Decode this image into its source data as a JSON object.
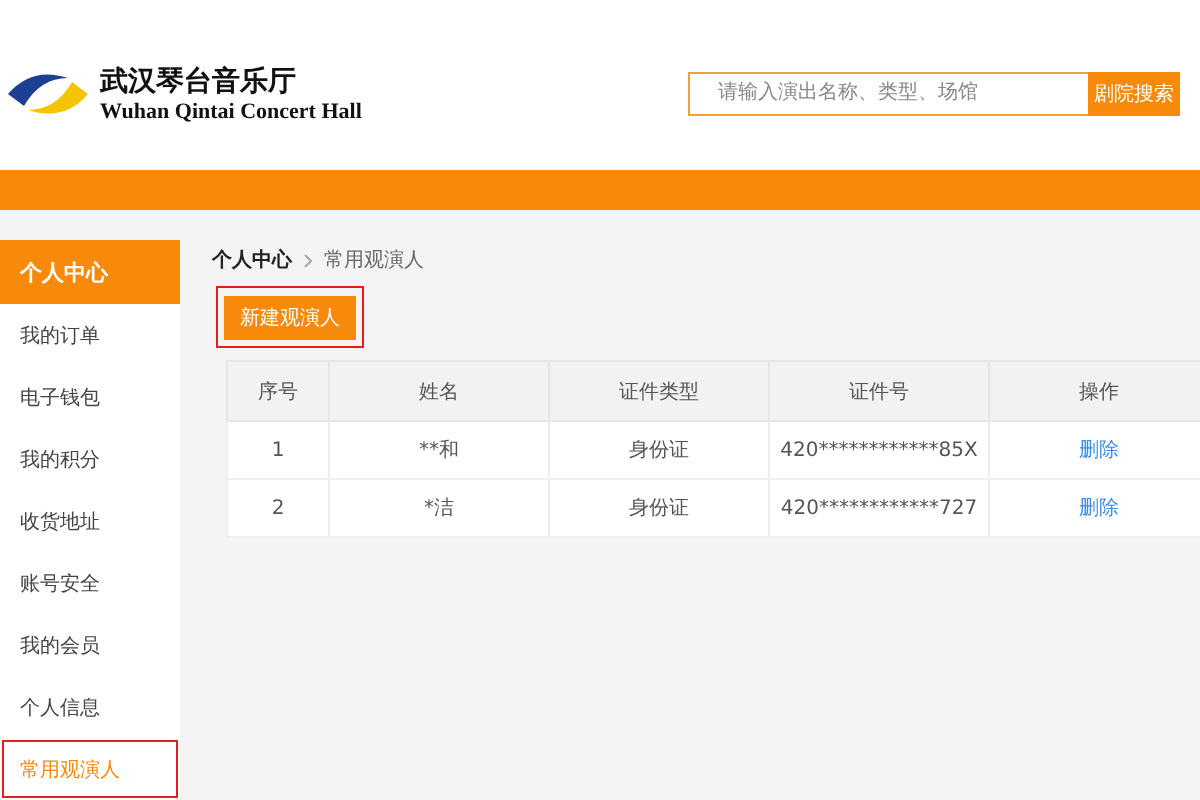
{
  "logo": {
    "title": "武汉琴台音乐厅",
    "subtitle": "Wuhan Qintai Concert Hall"
  },
  "search": {
    "placeholder": "请输入演出名称、类型、场馆",
    "button": "剧院搜索"
  },
  "sidebar": {
    "title": "个人中心",
    "items": [
      {
        "label": "我的订单",
        "selected": false,
        "highlighted": false
      },
      {
        "label": "电子钱包",
        "selected": false,
        "highlighted": false
      },
      {
        "label": "我的积分",
        "selected": false,
        "highlighted": false
      },
      {
        "label": "收货地址",
        "selected": false,
        "highlighted": false
      },
      {
        "label": "账号安全",
        "selected": false,
        "highlighted": false
      },
      {
        "label": "我的会员",
        "selected": false,
        "highlighted": false
      },
      {
        "label": "个人信息",
        "selected": false,
        "highlighted": false
      },
      {
        "label": "常用观演人",
        "selected": true,
        "highlighted": true
      }
    ]
  },
  "breadcrumb": [
    "个人中心",
    "常用观演人"
  ],
  "new_button": {
    "label": "新建观演人",
    "highlighted": true
  },
  "table": {
    "columns": [
      "序号",
      "姓名",
      "证件类型",
      "证件号",
      "操作"
    ],
    "rows": [
      [
        "1",
        "**和",
        "身份证",
        "420************85X",
        "删除"
      ],
      [
        "2",
        "*洁",
        "身份证",
        "420************727",
        "删除"
      ]
    ]
  }
}
